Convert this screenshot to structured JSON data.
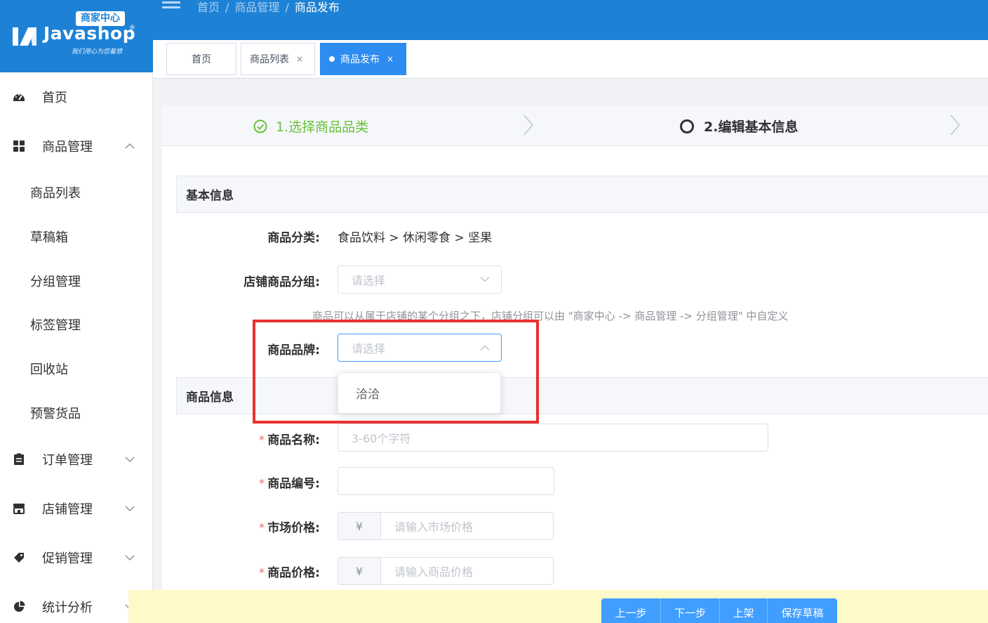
{
  "brand": {
    "badge": "商家中心",
    "name": "Javashop",
    "registered": "®",
    "slogan": "我们用心为您着想",
    "color": "#1d82d6"
  },
  "sidebar": {
    "items": [
      {
        "label": "首页",
        "icon": "dashboard-icon"
      },
      {
        "label": "商品管理",
        "icon": "grid-icon",
        "expanded": true,
        "children": [
          "商品列表",
          "草稿箱",
          "分组管理",
          "标签管理",
          "回收站",
          "预警货品"
        ]
      },
      {
        "label": "订单管理",
        "icon": "clipboard-icon"
      },
      {
        "label": "店铺管理",
        "icon": "shop-icon"
      },
      {
        "label": "促销管理",
        "icon": "tag-icon"
      },
      {
        "label": "统计分析",
        "icon": "pie-chart-icon"
      }
    ]
  },
  "header": {
    "breadcrumb": [
      "首页",
      "商品管理",
      "商品发布"
    ],
    "breadcrumb_sep": "/"
  },
  "tabs": [
    {
      "label": "首页",
      "closable": false
    },
    {
      "label": "商品列表",
      "closable": true
    },
    {
      "label": "商品发布",
      "closable": true,
      "active": true
    }
  ],
  "tab_close": "×",
  "steps": [
    {
      "label": "1.选择商品品类",
      "status": "done"
    },
    {
      "label": "2.编辑基本信息",
      "status": "current"
    }
  ],
  "form": {
    "basic_title": "基本信息",
    "category_label": "商品分类:",
    "category_value": "食品饮料 > 休闲零食 > 坚果",
    "group_label": "店铺商品分组:",
    "group_placeholder": "请选择",
    "group_hint": "商品可以从属于店铺的某个分组之下，店铺分组可以由 \"商家中心 -> 商品管理 -> 分组管理\" 中自定义",
    "brand_label": "商品品牌:",
    "brand_placeholder": "请选择",
    "brand_options": [
      "洽洽"
    ],
    "goods_title": "商品信息",
    "required_mark": "*",
    "name_label": "商品名称:",
    "name_placeholder": "3-60个字符",
    "sn_label": "商品编号:",
    "sn_value": "",
    "market_price_label": "市场价格:",
    "market_price_placeholder": "请输入市场价格",
    "price_label": "商品价格:",
    "price_placeholder": "请输入商品价格",
    "currency": "¥"
  },
  "actions": [
    "上一步",
    "下一步",
    "上架",
    "保存草稿"
  ]
}
